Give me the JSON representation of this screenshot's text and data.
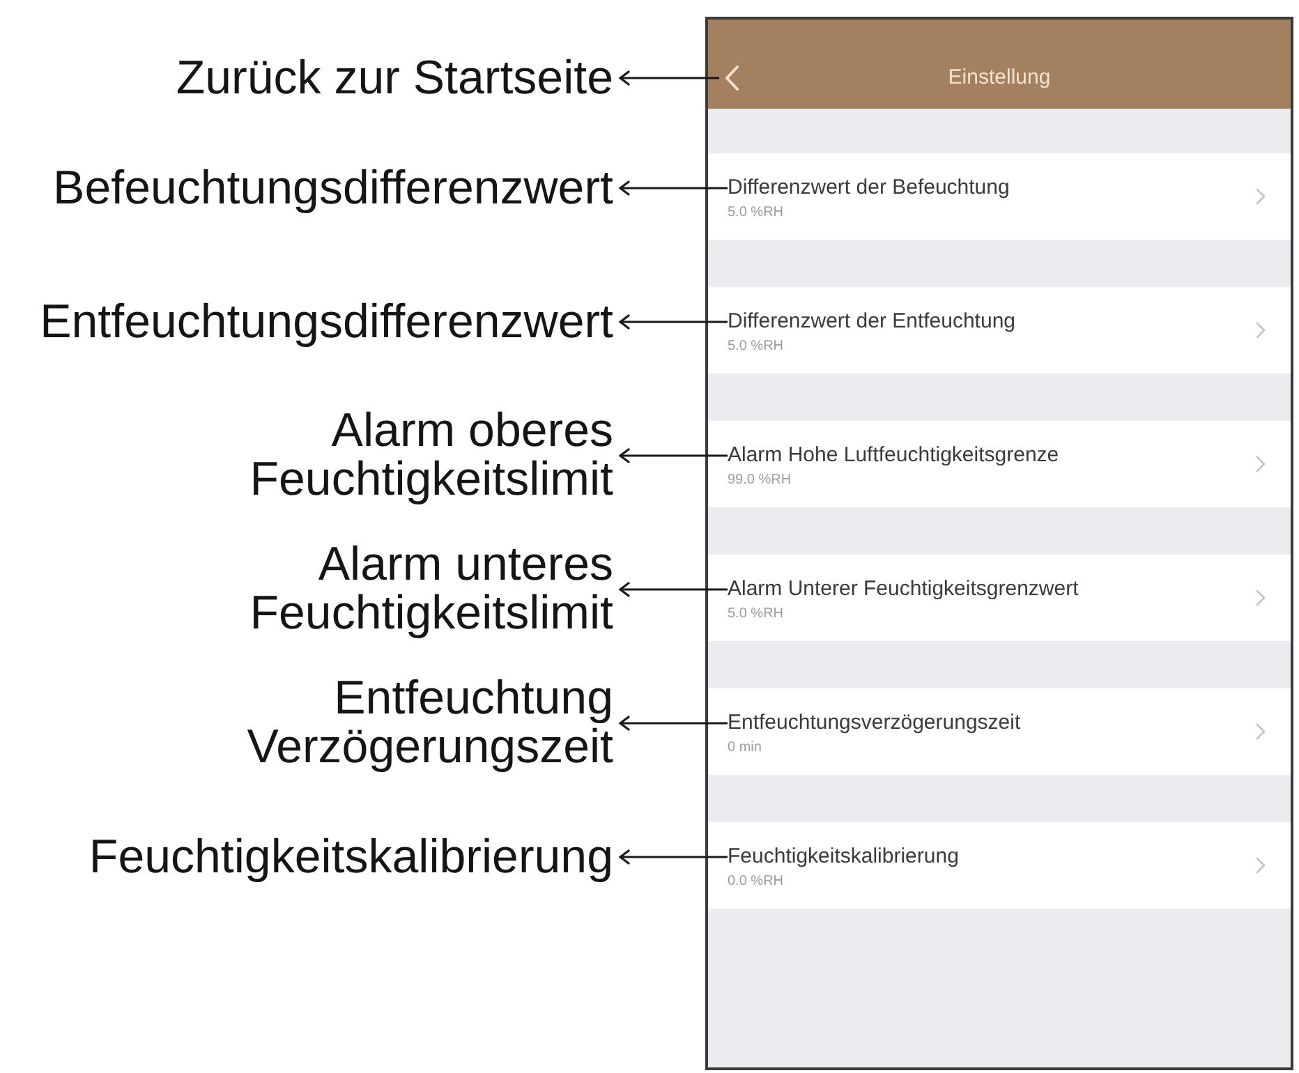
{
  "header": {
    "title": "Einstellung",
    "annotation": [
      "Zurück zur Startseite"
    ]
  },
  "settings": [
    {
      "title": "Differenzwert der Befeuchtung",
      "value": "5.0 %RH",
      "annotation": [
        "Befeuchtungsdifferenzwert"
      ]
    },
    {
      "title": "Differenzwert der Entfeuchtung",
      "value": "5.0 %RH",
      "annotation": [
        "Entfeuchtungsdifferenzwert"
      ]
    },
    {
      "title": "Alarm Hohe Luftfeuchtigkeitsgrenze",
      "value": "99.0 %RH",
      "annotation": [
        "Alarm oberes",
        "Feuchtigkeitslimit"
      ]
    },
    {
      "title": "Alarm Unterer Feuchtigkeitsgrenzwert",
      "value": "5.0 %RH",
      "annotation": [
        "Alarm unteres",
        "Feuchtigkeitslimit"
      ]
    },
    {
      "title": "Entfeuchtungsverzögerungszeit",
      "value": "0 min",
      "annotation": [
        "Entfeuchtung",
        "Verzögerungszeit"
      ]
    },
    {
      "title": "Feuchtigkeitskalibrierung",
      "value": "0.0 %RH",
      "annotation": [
        "Feuchtigkeitskalibrierung"
      ]
    }
  ]
}
